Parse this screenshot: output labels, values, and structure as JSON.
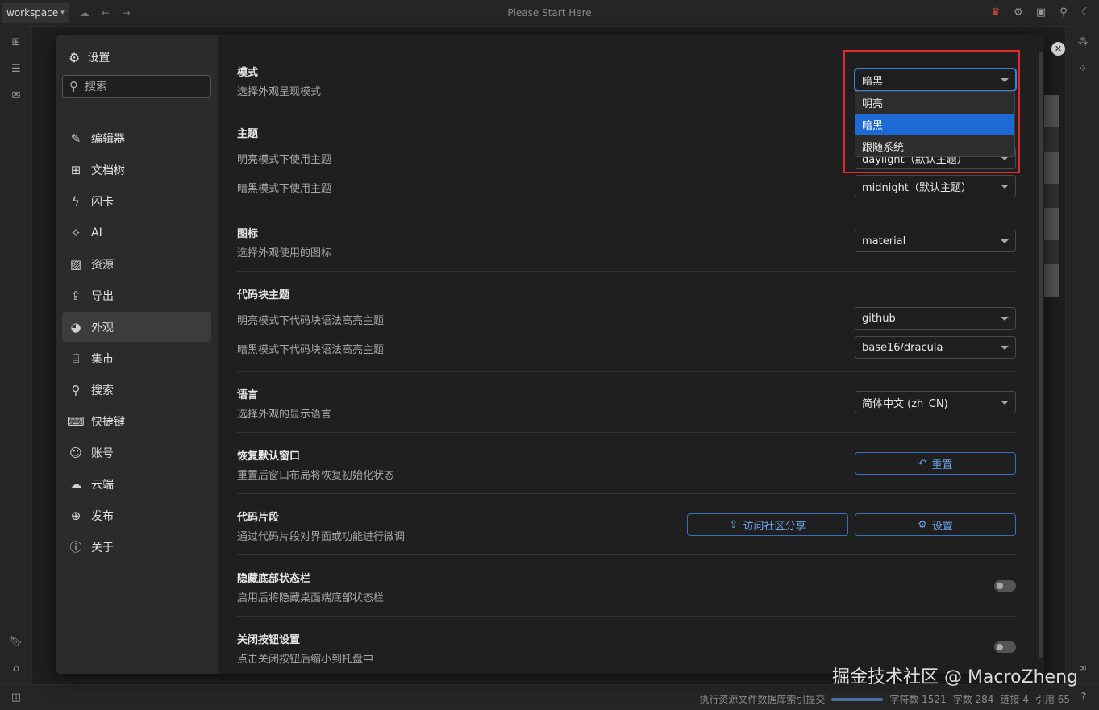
{
  "topbar": {
    "workspace": "workspace",
    "title": "Please Start Here"
  },
  "settings": {
    "title": "设置",
    "search_placeholder": "搜索",
    "nav": [
      {
        "label": "编辑器",
        "icon": "pencil-icon"
      },
      {
        "label": "文档树",
        "icon": "tree-icon"
      },
      {
        "label": "闪卡",
        "icon": "flash-icon"
      },
      {
        "label": "AI",
        "icon": "sparkle-icon"
      },
      {
        "label": "资源",
        "icon": "image-icon"
      },
      {
        "label": "导出",
        "icon": "export-icon"
      },
      {
        "label": "外观",
        "icon": "palette-icon"
      },
      {
        "label": "集市",
        "icon": "store-icon"
      },
      {
        "label": "搜索",
        "icon": "search-icon"
      },
      {
        "label": "快捷键",
        "icon": "keyboard-icon"
      },
      {
        "label": "账号",
        "icon": "user-icon"
      },
      {
        "label": "云端",
        "icon": "cloud-icon"
      },
      {
        "label": "发布",
        "icon": "globe-icon"
      },
      {
        "label": "关于",
        "icon": "info-icon"
      }
    ],
    "active_nav": "外观"
  },
  "appearance": {
    "mode": {
      "title": "模式",
      "desc": "选择外观呈现模式",
      "value": "暗黑"
    },
    "mode_options": [
      "明亮",
      "暗黑",
      "跟随系统"
    ],
    "theme": {
      "title": "主题",
      "light_label": "明亮模式下使用主题",
      "light_value": "daylight（默认主题）",
      "dark_label": "暗黑模式下使用主题",
      "dark_value": "midnight（默认主题）"
    },
    "icon": {
      "title": "图标",
      "desc": "选择外观使用的图标",
      "value": "material"
    },
    "code_theme": {
      "title": "代码块主题",
      "light_label": "明亮模式下代码块语法高亮主题",
      "light_value": "github",
      "dark_label": "暗黑模式下代码块语法高亮主题",
      "dark_value": "base16/dracula"
    },
    "language": {
      "title": "语言",
      "desc": "选择外观的显示语言",
      "value": "简体中文 (zh_CN)"
    },
    "reset_window": {
      "title": "恢复默认窗口",
      "desc": "重置后窗口布局将恢复初始化状态",
      "button": "重置"
    },
    "snippets": {
      "title": "代码片段",
      "desc": "通过代码片段对界面或功能进行微调",
      "share_button": "访问社区分享",
      "settings_button": "设置"
    },
    "hide_statusbar": {
      "title": "隐藏底部状态栏",
      "desc": "启用后将隐藏桌面端底部状态栏"
    },
    "close_button": {
      "title": "关闭按钮设置",
      "desc": "点击关闭按钮后缩小到托盘中"
    }
  },
  "statusbar": {
    "task": "执行资源文件数据库索引提交",
    "chars": "字符数 1521",
    "words": "字数 284",
    "links": "链接 4",
    "refs": "引用 65"
  },
  "watermark": "掘金技术社区 @ MacroZheng",
  "colors": {
    "accent": "#1d6ad5",
    "highlight": "#e02b2b"
  }
}
